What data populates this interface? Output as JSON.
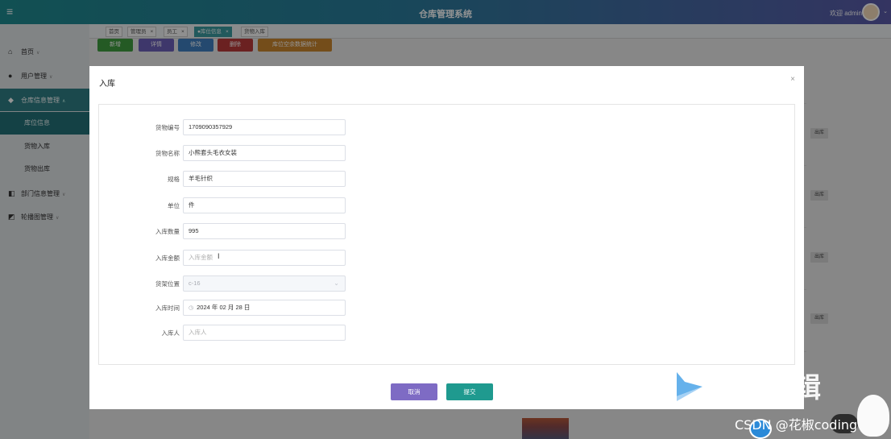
{
  "header": {
    "menu_glyph": "≡",
    "title": "仓库管理系统",
    "welcome": "欢迎 admin",
    "avatar_caret": "⌄"
  },
  "sidebar": {
    "items": [
      {
        "icon": "home-icon",
        "glyph": "⌂",
        "label": "首页"
      },
      {
        "icon": "user-icon",
        "glyph": "●",
        "label": "用户管理"
      },
      {
        "icon": "droplet-icon",
        "glyph": "◆",
        "label": "仓库信息管理"
      },
      {
        "label": "库位信息"
      },
      {
        "label": "货物入库"
      },
      {
        "label": "货物出库"
      },
      {
        "icon": "department-icon",
        "glyph": "◧",
        "label": "部门信息管理"
      },
      {
        "icon": "gallery-icon",
        "glyph": "◩",
        "label": "轮播图管理"
      }
    ]
  },
  "tabs": [
    {
      "label": "首页",
      "closable": false
    },
    {
      "label": "管理员",
      "closable": true
    },
    {
      "label": "员工",
      "closable": true
    },
    {
      "label": "●库位信息",
      "closable": true
    },
    {
      "label": "货物入库",
      "closable": false
    }
  ],
  "toolbar": {
    "buttons": [
      {
        "label": "新增",
        "color": "#3f9b3f"
      },
      {
        "label": "详情",
        "color": "#6c5fb8"
      },
      {
        "label": "修改",
        "color": "#3f7fbf"
      },
      {
        "label": "删除",
        "color": "#b83a3a"
      },
      {
        "label": "库位空余数据统计",
        "color": "#c8862e"
      }
    ]
  },
  "table": {
    "row_action_label": "出库"
  },
  "dialog": {
    "title": "入库",
    "close_glyph": "×",
    "fields": [
      {
        "label": "货物编号",
        "value": "1709090357929",
        "placeholder": ""
      },
      {
        "label": "货物名称",
        "value": "小熊套头毛衣女装",
        "placeholder": ""
      },
      {
        "label": "规格",
        "value": "羊毛针织",
        "placeholder": ""
      },
      {
        "label": "单位",
        "value": "件",
        "placeholder": ""
      },
      {
        "label": "入库数量",
        "value": "995",
        "placeholder": ""
      },
      {
        "label": "入库金额",
        "value": "",
        "placeholder": "入库金额"
      },
      {
        "label": "货架位置",
        "value": "c-16",
        "placeholder": ""
      },
      {
        "label": "入库时间",
        "value": "2024 年 02 月 28 日",
        "placeholder": ""
      },
      {
        "label": "入库人",
        "value": "",
        "placeholder": "入库人"
      }
    ],
    "cancel_label": "取消",
    "submit_label": "提交"
  },
  "watermark": {
    "text": "辑",
    "csdn": "CSDN @花椒coding"
  }
}
